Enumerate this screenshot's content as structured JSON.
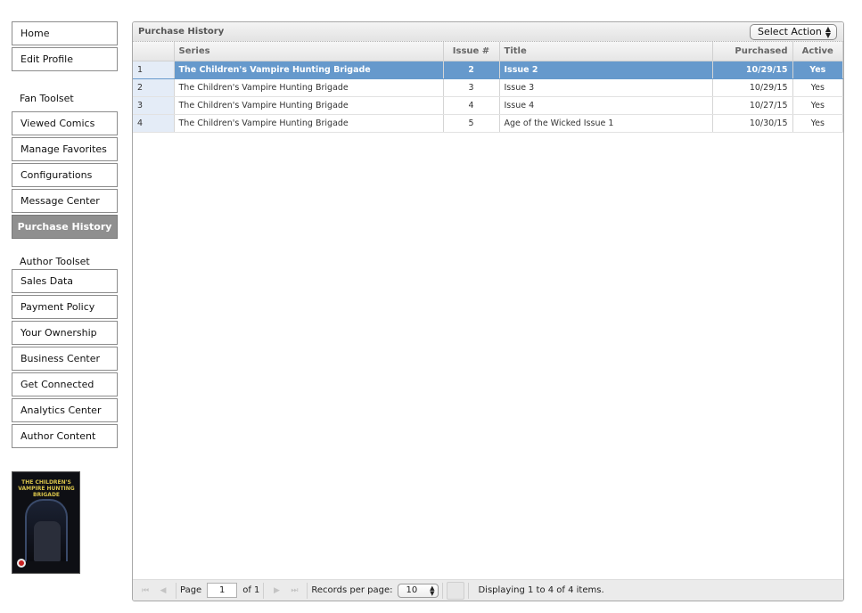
{
  "sidebar": {
    "top_items": [
      {
        "label": "Home"
      },
      {
        "label": "Edit Profile"
      }
    ],
    "fan_toolset_label": "Fan Toolset",
    "fan_items": [
      {
        "label": "Viewed Comics"
      },
      {
        "label": "Manage Favorites"
      },
      {
        "label": "Configurations"
      },
      {
        "label": "Message Center"
      },
      {
        "label": "Purchase History",
        "active": true
      }
    ],
    "author_toolset_label": "Author Toolset",
    "author_items": [
      {
        "label": "Sales Data"
      },
      {
        "label": "Payment Policy"
      },
      {
        "label": "Your Ownership"
      },
      {
        "label": "Business Center"
      },
      {
        "label": "Get Connected"
      },
      {
        "label": "Analytics Center"
      },
      {
        "label": "Author Content"
      }
    ],
    "thumbnail": {
      "title": "THE CHILDREN'S VAMPIRE HUNTING BRIGADE"
    }
  },
  "panel": {
    "title": "Purchase History",
    "select_action": "Select Action",
    "columns": [
      "",
      "Series",
      "Issue #",
      "Title",
      "Purchased",
      "Active"
    ],
    "rows": [
      {
        "num": "1",
        "series": "The Children's Vampire Hunting Brigade",
        "issue": "2",
        "title": "Issue 2",
        "purchased": "10/29/15",
        "active": "Yes",
        "selected": true
      },
      {
        "num": "2",
        "series": "The Children's Vampire Hunting Brigade",
        "issue": "3",
        "title": "Issue 3",
        "purchased": "10/29/15",
        "active": "Yes"
      },
      {
        "num": "3",
        "series": "The Children's Vampire Hunting Brigade",
        "issue": "4",
        "title": "Issue 4",
        "purchased": "10/27/15",
        "active": "Yes"
      },
      {
        "num": "4",
        "series": "The Children's Vampire Hunting Brigade",
        "issue": "5",
        "title": "Age of the Wicked Issue 1",
        "purchased": "10/30/15",
        "active": "Yes"
      }
    ]
  },
  "pager": {
    "first_icon": "first-page-icon",
    "prev_icon": "prev-page-icon",
    "next_icon": "next-page-icon",
    "last_icon": "last-page-icon",
    "page_label": "Page",
    "page_value": "1",
    "of_label": "of 1",
    "records_label": "Records per page:",
    "records_value": "10",
    "display_text": "Displaying 1 to 4 of 4 items."
  },
  "colors": {
    "selected_row": "#6699cc",
    "active_nav": "#8f8f8f",
    "row_number_bg": "#e4ecf7"
  }
}
